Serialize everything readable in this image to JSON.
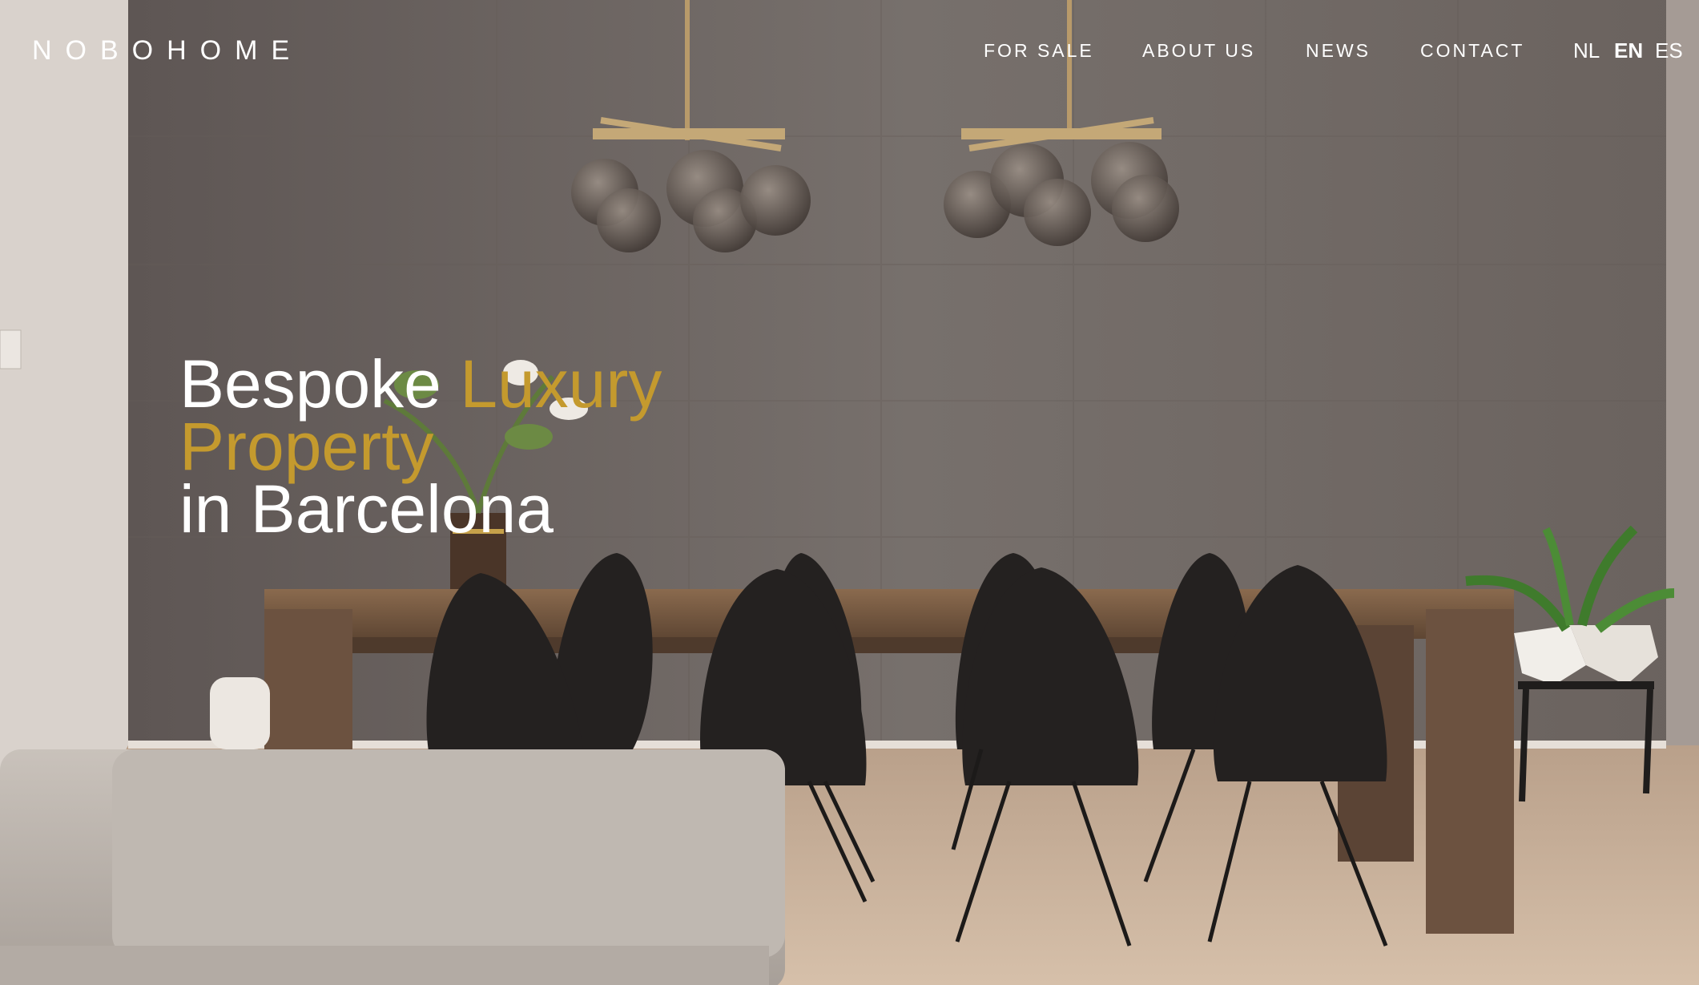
{
  "brand": {
    "logo": "NOBOHOME"
  },
  "nav": {
    "items": [
      {
        "label": "FOR SALE"
      },
      {
        "label": "ABOUT US"
      },
      {
        "label": "NEWS"
      },
      {
        "label": "CONTACT"
      }
    ],
    "languages": [
      {
        "label": "NL",
        "active": false
      },
      {
        "label": "EN",
        "active": true
      },
      {
        "label": "ES",
        "active": false
      }
    ]
  },
  "hero": {
    "line1_white": "Bespoke ",
    "line1_gold": "Luxury",
    "line2_gold": "Property",
    "line3_white": "in Barcelona"
  },
  "colors": {
    "accent_gold": "#c49a2e",
    "nav_text": "#ffffff",
    "wall": "#6f6763"
  },
  "background": {
    "image": "dining-room-interior"
  }
}
